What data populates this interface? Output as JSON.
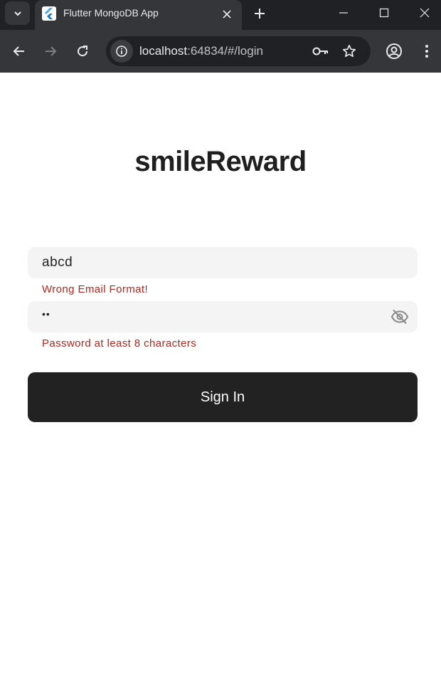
{
  "browser": {
    "tab_title": "Flutter MongoDB App",
    "url_host": "localhost",
    "url_rest": ":64834/#/login"
  },
  "page": {
    "title": "smileReward",
    "email": {
      "value": "abcd",
      "error": "Wrong Email Format!"
    },
    "password": {
      "value": "••",
      "error": "Password at least 8 characters"
    },
    "signin_label": "Sign In"
  },
  "colors": {
    "error": "#b3261e",
    "button": "#222222",
    "field_bg": "#f4f4f4"
  }
}
